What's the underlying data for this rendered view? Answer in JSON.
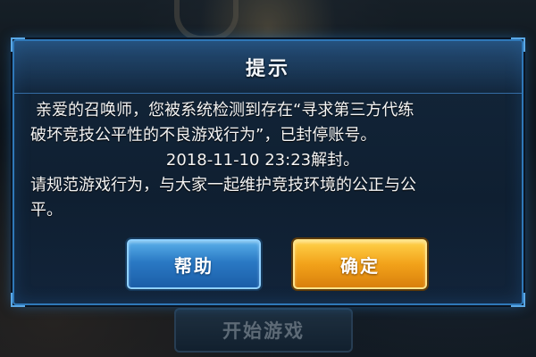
{
  "dialog": {
    "title": "提示",
    "lines": [
      "亲爱的召唤师，您被系统检测到存在“寻求第三方代练",
      "破坏竞技公平性的不良游戏行为”，已封停账号。",
      "2018-11-10 23:23解封。",
      "请规范游戏行为，与大家一起维护竞技环境的公正与公",
      "平。"
    ],
    "help_button": "帮助",
    "confirm_button": "确定"
  },
  "background": {
    "start_game_button": "开始游戏"
  },
  "colors": {
    "dialog_border": "#2f78b8",
    "help_button": "#2a79c4",
    "confirm_button": "#f2a21a"
  }
}
